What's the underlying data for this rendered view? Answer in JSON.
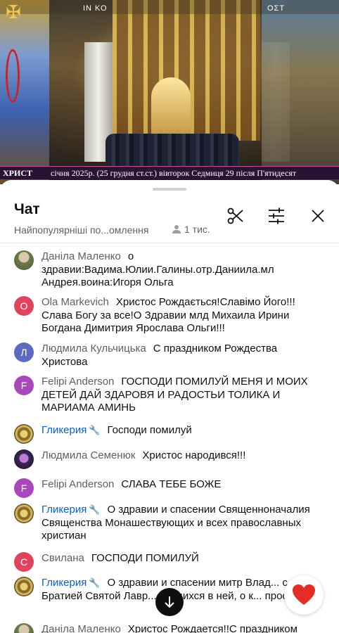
{
  "video": {
    "top_label_left": "ΙΝ ΚΟ",
    "top_label_right": "ΟΣΤ",
    "ticker_left": "ХРИСТ",
    "ticker_text": "січня 2025р. (25 грудня ст.ст.) вівторок   Седмиця 29 після П'ятидесят"
  },
  "chat": {
    "title": "Чат",
    "sort_label": "Найпопулярніші по...омлення",
    "viewers": "1 тис.",
    "messages": [
      {
        "author": "Даніла Маленко",
        "author_type": "normal",
        "avatar_type": "photo1",
        "avatar_letter": "",
        "avatar_color": "#5a6b3e",
        "text": "о здравии:Вадима.Юлии.Галины.отр.Даниила.мл Андрея.воина:Игоря Ольга"
      },
      {
        "author": "Ola Markevich",
        "author_type": "normal",
        "avatar_type": "letter",
        "avatar_letter": "O",
        "avatar_color": "#e0435c",
        "text": "Христос Рождається!Славімо Його!!! Слава Богу за все!О Здравии млд Михаила Ирини Богдана Димитрия Ярослава Ольги!!!"
      },
      {
        "author": "Людмила Кульчицька",
        "author_type": "normal",
        "avatar_type": "letter",
        "avatar_letter": "Л",
        "avatar_color": "#5c6bc0",
        "text": "С праздником Рождества Христова"
      },
      {
        "author": "Felipi Anderson",
        "author_type": "normal",
        "avatar_type": "letter",
        "avatar_letter": "F",
        "avatar_color": "#ab47bc",
        "text": "ГОСПОДИ ПОМИЛУЙ МЕНЯ И МОИХ ДЕТЕЙ ДАЙ ЗДАРОВЯ И РАДОСТЬИ ТОЛИКА И МАРИАМА АМИНЬ"
      },
      {
        "author": "Гликерия",
        "author_type": "owner",
        "avatar_type": "icon",
        "avatar_letter": "",
        "avatar_color": "#8a6a2a",
        "text": "Господи помилуй"
      },
      {
        "author": "Людмила Семенюк",
        "author_type": "normal",
        "avatar_type": "photo2",
        "avatar_letter": "",
        "avatar_color": "#3a2650",
        "text": "Христос народився!!!"
      },
      {
        "author": "Felipi Anderson",
        "author_type": "normal",
        "avatar_type": "letter",
        "avatar_letter": "F",
        "avatar_color": "#ab47bc",
        "text": "СЛАВА ТЕБЕ БОЖЕ"
      },
      {
        "author": "Гликерия",
        "author_type": "owner",
        "avatar_type": "icon",
        "avatar_letter": "",
        "avatar_color": "#8a6a2a",
        "text": "О здравии и спасении Священноначалия Священства Монашествующих и всех православных христиан"
      },
      {
        "author": "Свилана",
        "author_type": "normal",
        "avatar_type": "letter",
        "avatar_letter": "С",
        "avatar_color": "#e0435c",
        "text": "ГОСПОДИ ПОМИЛУЙ"
      },
      {
        "author": "Гликерия",
        "author_type": "owner",
        "avatar_type": "icon",
        "avatar_letter": "",
        "avatar_color": "#8a6a2a",
        "text": "О здравии и спасении митр Влад... с Братией Святой Лавр...олящихся в ней, о к... просим"
      },
      {
        "author": "Даніла Маленко",
        "author_type": "normal",
        "avatar_type": "photo1",
        "avatar_letter": "",
        "avatar_color": "#5a6b3e",
        "text": "Христос Рождается!!С праздником"
      }
    ]
  },
  "icons": {
    "scissors": "scissors-icon",
    "tune": "tune-icon",
    "close": "close-icon",
    "person": "person-icon",
    "wrench": "wrench-icon",
    "arrow_down": "arrow-down-icon",
    "heart": "heart-icon"
  },
  "colors": {
    "owner_name": "#065fd4",
    "author_name": "#606060",
    "heart": "#e52d27"
  }
}
